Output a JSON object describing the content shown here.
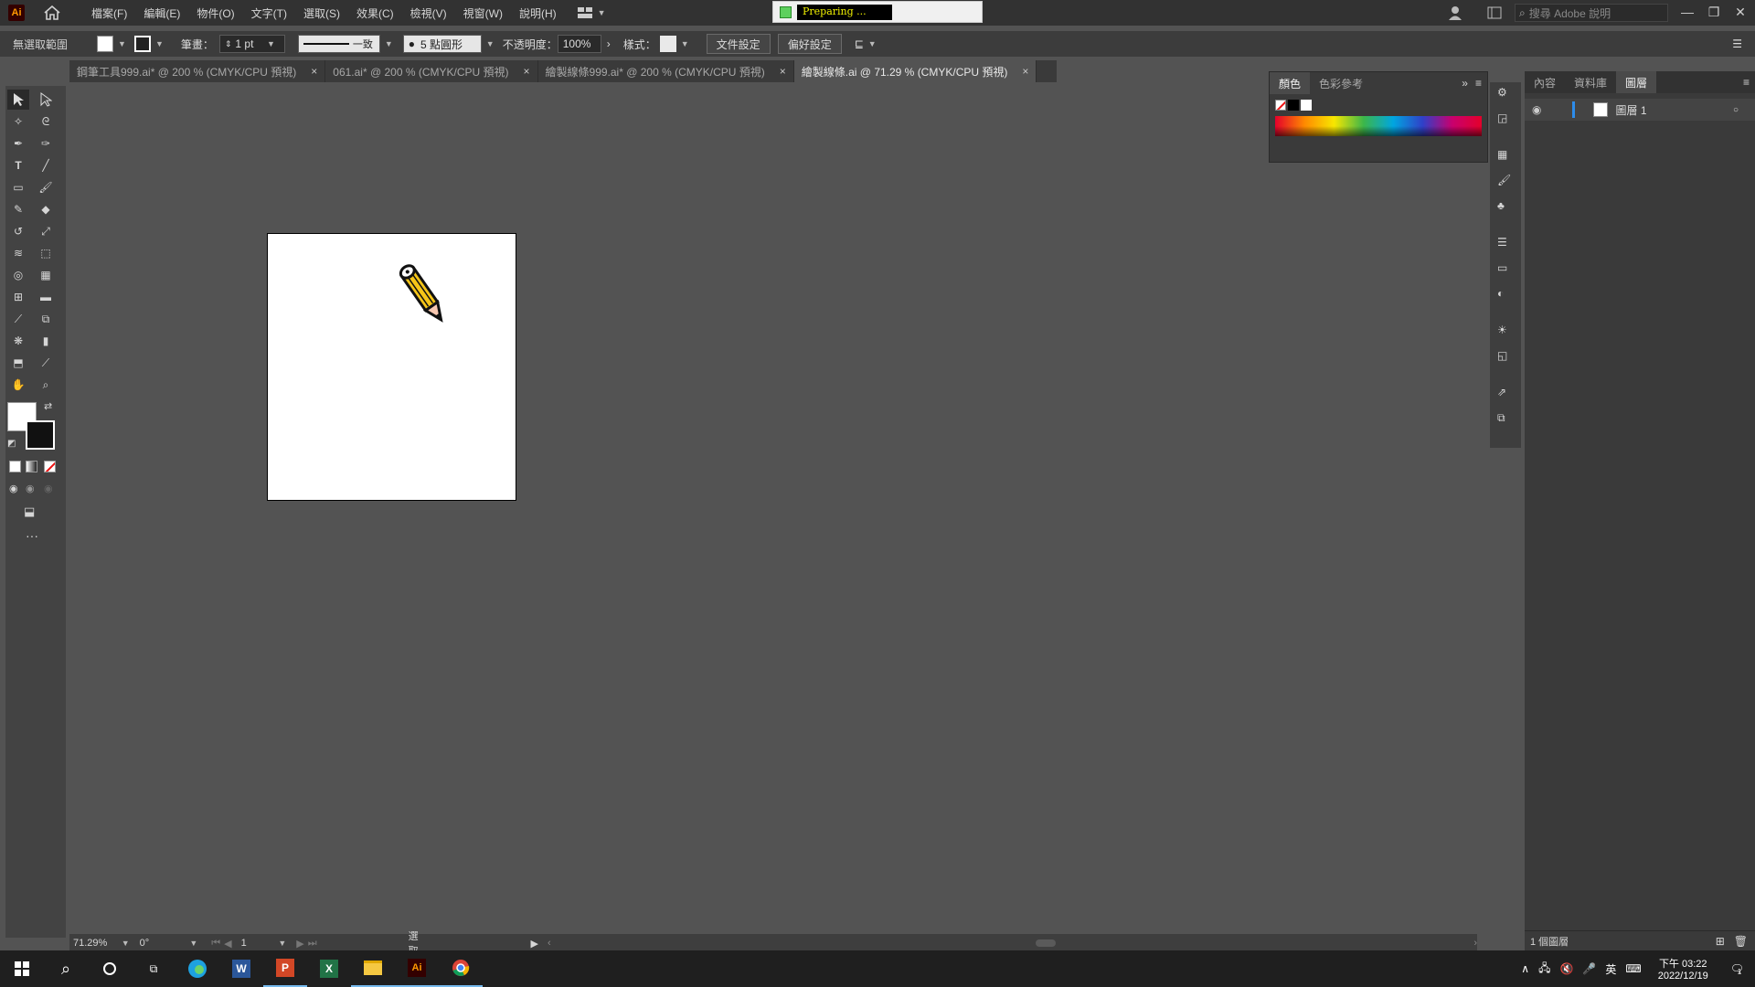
{
  "app": {
    "logo": "Ai",
    "home_icon": "home-icon"
  },
  "menu": [
    "檔案(F)",
    "編輯(E)",
    "物件(O)",
    "文字(T)",
    "選取(S)",
    "效果(C)",
    "檢視(V)",
    "視窗(W)",
    "說明(H)"
  ],
  "preparing": {
    "text": "Preparing ..."
  },
  "search": {
    "placeholder": "搜尋 Adobe 說明"
  },
  "control": {
    "selection": "無選取範圍",
    "stroke_label": "筆畫：",
    "stroke_value": "1 pt",
    "stroke_style": "一致",
    "brush": "5 點圓形",
    "opacity_label": "不透明度：",
    "opacity_value": "100%",
    "style_label": "樣式：",
    "doc_setup": "文件設定",
    "preferences": "偏好設定"
  },
  "tabs": [
    {
      "label": "鋼筆工具999.ai* @ 200 % (CMYK/CPU 預視)",
      "active": false
    },
    {
      "label": "061.ai* @ 200 % (CMYK/CPU 預視)",
      "active": false
    },
    {
      "label": "繪製線條999.ai* @ 200 % (CMYK/CPU 預視)",
      "active": false
    },
    {
      "label": "繪製線條.ai @ 71.29 % (CMYK/CPU 預視)",
      "active": true
    }
  ],
  "tab_close": "×",
  "color_panel": {
    "tab1": "顏色",
    "tab2": "色彩參考"
  },
  "layers_panel": {
    "tab1": "內容",
    "tab2": "資料庫",
    "tab3": "圖層",
    "layer_name": "圖層 1",
    "footer": "1 個圖層"
  },
  "status": {
    "zoom": "71.29%",
    "rotation": "0°",
    "page": "1",
    "tool": "選取"
  },
  "toolbar": {
    "more": "···"
  },
  "taskbar": {
    "time": "下午 03:22",
    "date": "2022/12/19",
    "ime": "英",
    "notif": "1"
  },
  "colors": {
    "bg": "#535353",
    "panel": "#3a3a3a",
    "menubar": "#323232",
    "accent": "#2d8ceb",
    "pencil_body": "#f5c518",
    "pencil_tip": "#f7c7b0"
  }
}
